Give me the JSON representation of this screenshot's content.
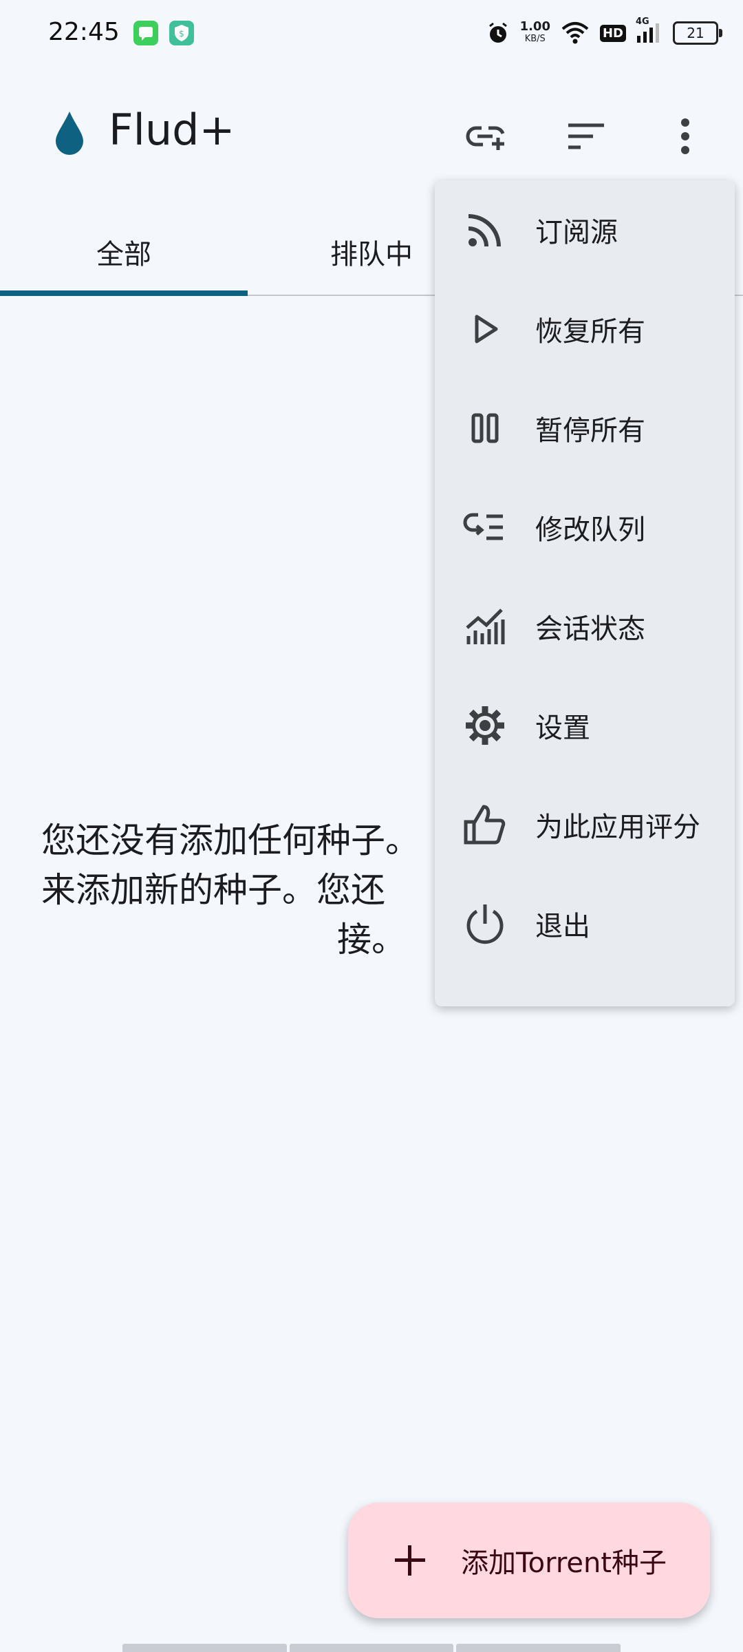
{
  "status_bar": {
    "time": "22:45",
    "net_speed_value": "1.00",
    "net_speed_unit": "KB/S",
    "hd_badge": "HD",
    "network_type": "4G",
    "battery_level": "21"
  },
  "app_bar": {
    "title": "Flud+",
    "icons": [
      "add-link-icon",
      "sort-icon",
      "more-vert-icon"
    ]
  },
  "tabs": [
    {
      "label": "全部",
      "selected": true
    },
    {
      "label": "排队中",
      "selected": false
    }
  ],
  "empty_state": {
    "line1": "您还没有添加任何种子。",
    "line2": "来添加新的种子。您还",
    "line3": "接。"
  },
  "overflow_menu": {
    "items": [
      {
        "label": "订阅源",
        "icon": "rss-feed-icon"
      },
      {
        "label": "恢复所有",
        "icon": "play-icon"
      },
      {
        "label": "暂停所有",
        "icon": "pause-icon"
      },
      {
        "label": "修改队列",
        "icon": "queue-icon"
      },
      {
        "label": "会话状态",
        "icon": "stats-icon"
      },
      {
        "label": "设置",
        "icon": "gear-icon"
      },
      {
        "label": "为此应用评分",
        "icon": "thumb-up-icon"
      },
      {
        "label": "退出",
        "icon": "power-icon"
      }
    ]
  },
  "fab": {
    "label": "添加Torrent种子"
  },
  "colors": {
    "accent": "#0e6181",
    "background": "#f4f8fd",
    "menu_background": "#e8ebf0",
    "fab_background": "#ffd9df",
    "fab_text": "#3b0712"
  }
}
